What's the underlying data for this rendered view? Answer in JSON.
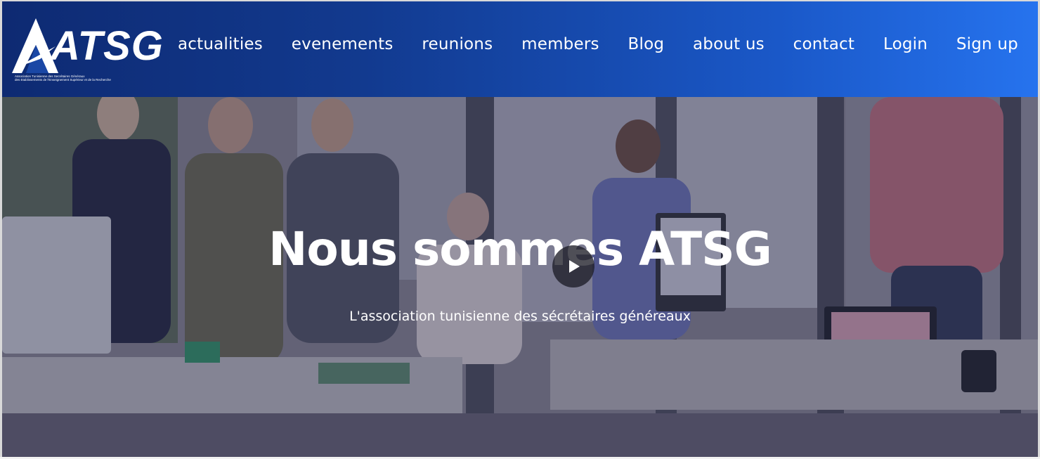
{
  "logo": {
    "text": "ATSG",
    "subtitle_line1": "Association Tunisienne des Secrétaires Généraux",
    "subtitle_line2": "des Etablissements de l'Enseignement Supérieur et de la Recherche"
  },
  "nav": {
    "items": [
      {
        "label": "actualities"
      },
      {
        "label": "evenements"
      },
      {
        "label": "reunions"
      },
      {
        "label": "members"
      },
      {
        "label": "Blog"
      },
      {
        "label": "about us"
      },
      {
        "label": "contact"
      },
      {
        "label": "Login"
      },
      {
        "label": "Sign up"
      }
    ]
  },
  "hero": {
    "title": "Nous sommes ATSG",
    "subtitle": "L'association tunisienne des sécrétaires généreaux",
    "play_icon": "play-icon"
  },
  "colors": {
    "header_start": "#0e2a72",
    "header_end": "#2673ee",
    "text": "#ffffff"
  }
}
